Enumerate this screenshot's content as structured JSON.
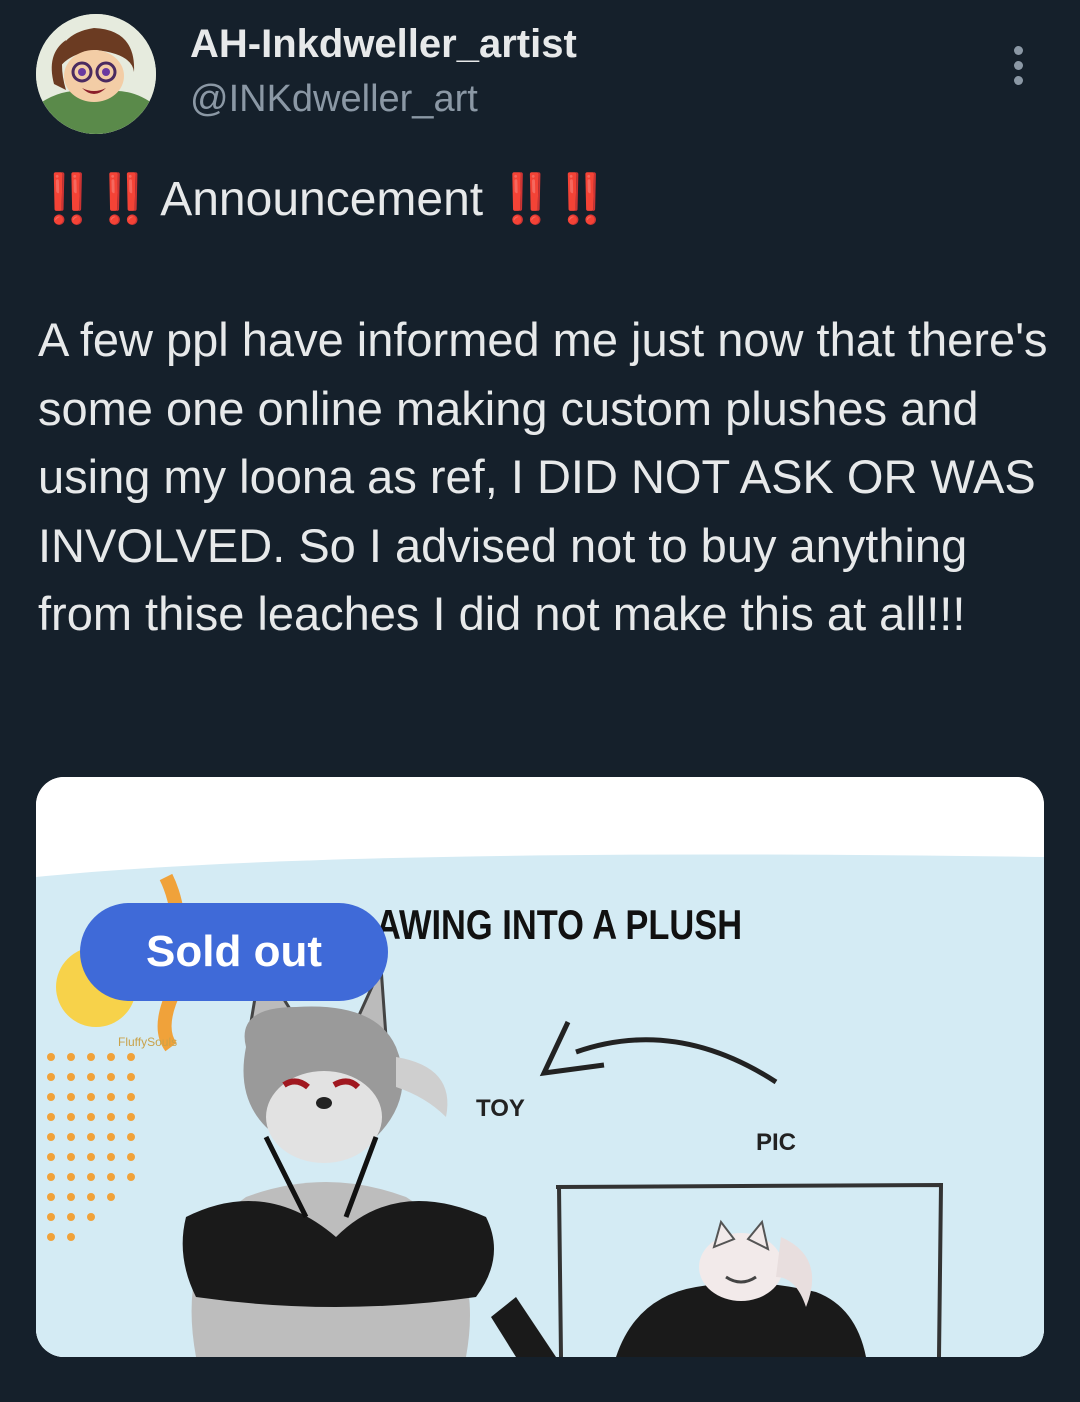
{
  "tweet": {
    "author_name": "AH-Inkdweller_artist",
    "author_handle": "@INKdweller_art",
    "avatar_icon": "cartoon-avatar",
    "more_icon": "more-vertical-icon",
    "headline_prefix": "‼️‼️",
    "headline_text": "Announcement",
    "headline_suffix": "‼️‼️",
    "body": "A few ppl have informed me just now that there's some one online making custom plushes and using my loona as ref, I DID NOT ASK OR WAS INVOLVED. So I advised not to buy anything from thise leaches I did not make this at all!!!"
  },
  "media": {
    "badge": "Sold out",
    "heading": "AWING INTO A PLUSH",
    "label_toy": "TOY",
    "label_pic": "PIC",
    "watermark": "FluffySouls"
  },
  "colors": {
    "background": "#15202b",
    "text": "#e7e9ea",
    "secondary": "#8b98a5",
    "alert": "#e0282e",
    "badge": "#3f6ad8"
  }
}
